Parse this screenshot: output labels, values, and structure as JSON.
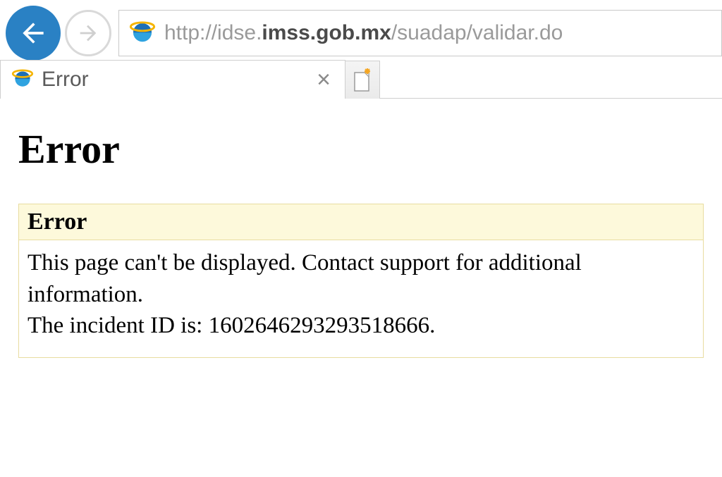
{
  "address": {
    "prefix": "http://idse.",
    "host_bold": "imss.gob.mx",
    "suffix": "/suadap/validar.do"
  },
  "tab": {
    "title": "Error",
    "close_glyph": "×"
  },
  "page": {
    "heading": "Error",
    "box_header": "Error",
    "body_line1": "This page can't be displayed. Contact support for additional information.",
    "body_line2_prefix": "The incident ID is: ",
    "incident_id": "1602646293293518666",
    "body_line2_suffix": "."
  }
}
